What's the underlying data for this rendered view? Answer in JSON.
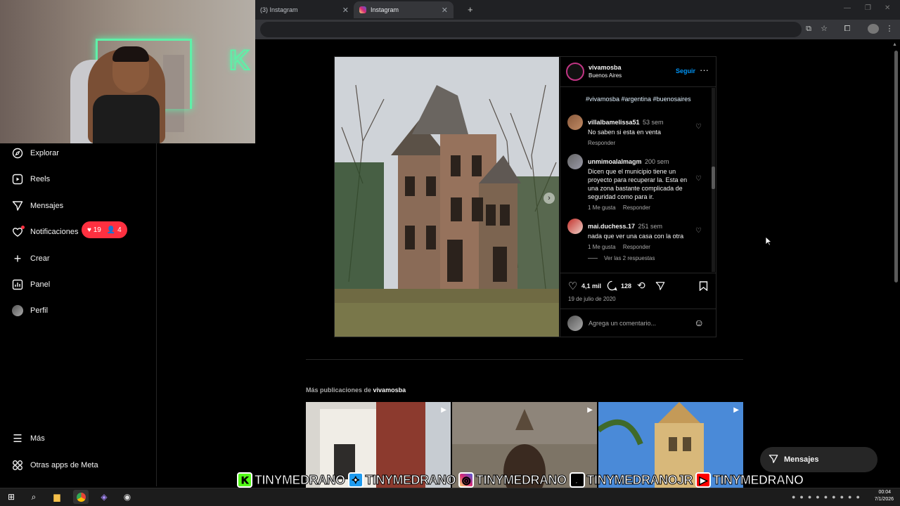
{
  "browser": {
    "tabs": [
      {
        "label": "(3) Instagram"
      },
      {
        "label": "Instagram"
      }
    ],
    "new_tab": "+"
  },
  "nav": {
    "items": [
      {
        "label": "Explorar",
        "icon": "compass-icon"
      },
      {
        "label": "Reels",
        "icon": "reels-icon"
      },
      {
        "label": "Mensajes",
        "icon": "paper-plane-icon"
      },
      {
        "label": "Notificaciones",
        "icon": "heart-icon"
      },
      {
        "label": "Crear",
        "icon": "plus-icon"
      },
      {
        "label": "Panel",
        "icon": "chart-icon"
      },
      {
        "label": "Perfil",
        "icon": "avatar-icon"
      }
    ],
    "notifications_badge": {
      "likes": "19",
      "follows": "4"
    },
    "bottom": [
      {
        "label": "Más",
        "icon": "hamburger-icon"
      },
      {
        "label": "Otras apps de Meta",
        "icon": "meta-apps-icon"
      }
    ]
  },
  "post": {
    "username": "vivamosba",
    "location": "Buenos Aires",
    "follow_label": "Seguir",
    "hashtags": "#vivamosba #argentina #buenosaires",
    "comments": [
      {
        "user": "villalbamelissa51",
        "time": "53 sem",
        "text": "No saben si esta en venta",
        "likes": "",
        "reply": "Responder"
      },
      {
        "user": "unmimoalalmagm",
        "time": "200 sem",
        "text": "Dicen que el municipio tiene un proyecto para recuperar la. Esta en una zona bastante complicada de seguridad como para ir.",
        "likes": "1 Me gusta",
        "reply": "Responder"
      },
      {
        "user": "mai.duchess.17",
        "time": "251 sem",
        "text": "nada que ver una casa con la otra",
        "likes": "1 Me gusta",
        "reply": "Responder"
      }
    ],
    "view_replies": "Ver las 2 respuestas",
    "like_count": "4,1 mil",
    "comment_count": "128",
    "date": "19 de julio de 2020",
    "comment_placeholder": "Agrega un comentario..."
  },
  "more_posts": {
    "prefix": "Más publicaciones de",
    "user": "vivamosba"
  },
  "messages_float": {
    "label": "Mensajes"
  },
  "overlay": {
    "handles": [
      {
        "platform": "kick",
        "handle": "TINYMEDRANO",
        "color": "#53fc18"
      },
      {
        "platform": "twitter",
        "handle": "TINYMEDRANO",
        "color": "#1d9bf0"
      },
      {
        "platform": "instagram",
        "handle": "TINYMEDRANO",
        "color": "#d62976"
      },
      {
        "platform": "tiktok",
        "handle": "TINYMEDRANOJR",
        "color": "#000000"
      },
      {
        "platform": "youtube",
        "handle": "TINYMEDRANO",
        "color": "#ff0000"
      }
    ]
  },
  "taskbar": {
    "time": "00:04",
    "date": "7/1/2026"
  },
  "colors": {
    "accent": "#0095f6",
    "badge": "#ff3040",
    "hashtag": "#e0f1ff"
  }
}
